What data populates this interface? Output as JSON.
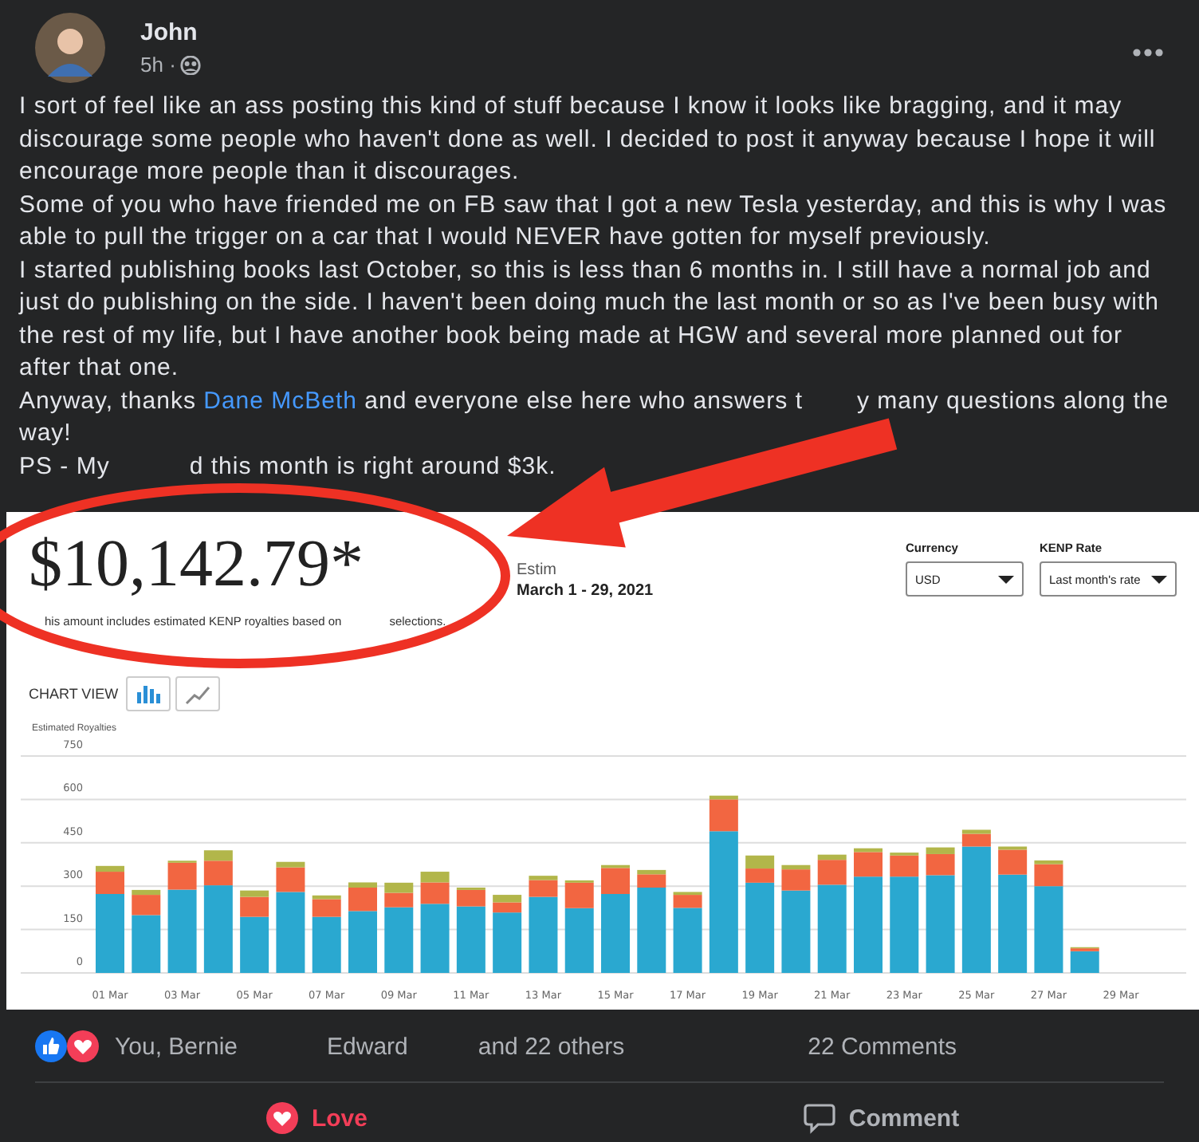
{
  "post": {
    "author": "John",
    "time": "5h ·",
    "paragraphs": [
      "I sort of feel like an ass posting this kind of stuff because I know it looks like bragging, and it may discourage some people who haven't done as well. I decided to post it anyway because I hope it will encourage more people than it discourages.",
      "Some of you who have friended me on FB saw that I got a new Tesla yesterday, and this is why I was able to pull the trigger on a car that I would NEVER have gotten for myself previously.",
      "I started publishing books last October, so this is less than 6 months in. I still have a normal job and just do publishing on the side. I haven't been doing much the last month or so as I've been busy with the rest of my life, but I have another book being made at HGW and several more planned out for after that one."
    ],
    "closing": {
      "before": "Anyway, thanks ",
      "link": "Dane McBeth",
      "after": " and everyone else here who answers t",
      "rest": "y many questions along the",
      "rest_wrap": "way!"
    },
    "ps": {
      "start": "PS - My",
      "end": "d this month is right around $3k."
    }
  },
  "report": {
    "amount": "$10,142.79*",
    "period_label": "Estim",
    "period": "March 1 - 29, 2021",
    "note_start": "his amount includes estimated KENP royalties based on",
    "note_end": "selections.",
    "chart_view_label": "CHART VIEW",
    "chart_views": [
      {
        "kind": "bar",
        "selected": true
      },
      {
        "kind": "line",
        "selected": false
      }
    ],
    "filters": [
      {
        "label": "Currency",
        "value": "USD"
      },
      {
        "label": "KENP Rate",
        "value": "Last month's rate"
      }
    ],
    "chart_data": {
      "type": "bar",
      "stacked": true,
      "grid": true,
      "ylabel": "Estimated Royalties",
      "categories": [
        "01 Mar",
        null,
        "03 Mar",
        null,
        "05 Mar",
        null,
        "07 Mar",
        null,
        "09 Mar",
        null,
        "11 Mar",
        null,
        "13 Mar",
        null,
        "15 Mar",
        null,
        "17 Mar",
        null,
        "19 Mar",
        null,
        "21 Mar",
        null,
        "23 Mar",
        null,
        "25 Mar",
        null,
        "27 Mar",
        null,
        "29 Mar"
      ],
      "ylim": [
        0,
        750
      ],
      "yticks": [
        0,
        150,
        300,
        450,
        600,
        750
      ],
      "series": [
        {
          "color": "#2aa8d0",
          "values": [
            273,
            200,
            288,
            303,
            194,
            280,
            194,
            214,
            227,
            239,
            230,
            209,
            263,
            224,
            273,
            295,
            225,
            490,
            312,
            285,
            305,
            333,
            333,
            338,
            437,
            340,
            300,
            75,
            null
          ]
        },
        {
          "color": "#f26641",
          "values": [
            77,
            70,
            93,
            85,
            69,
            85,
            61,
            81,
            50,
            74,
            57,
            35,
            58,
            88,
            90,
            46,
            45,
            110,
            49,
            73,
            86,
            85,
            73,
            73,
            44,
            86,
            76,
            10,
            null
          ]
        },
        {
          "color": "#b2b64a",
          "values": [
            20,
            17,
            7,
            36,
            22,
            19,
            13,
            18,
            35,
            37,
            8,
            26,
            15,
            8,
            10,
            15,
            10,
            13,
            45,
            15,
            18,
            13,
            10,
            23,
            14,
            11,
            13,
            4,
            null
          ]
        }
      ]
    }
  },
  "reactions": {
    "names": [
      "You, Bernie",
      "Edward",
      "and 22 others"
    ],
    "comments": "22 Comments"
  },
  "actions": [
    {
      "kind": "love",
      "label": "Love",
      "selected": true
    },
    {
      "kind": "comment",
      "label": "Comment",
      "selected": false
    }
  ]
}
